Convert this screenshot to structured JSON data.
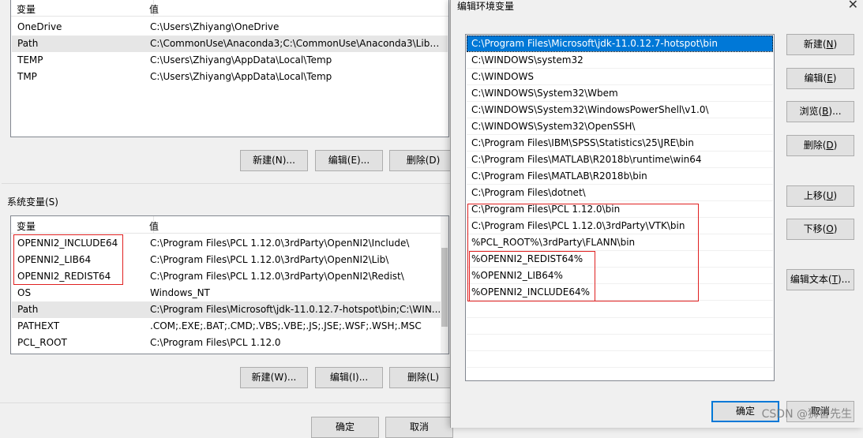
{
  "user_vars": {
    "header": {
      "name": "变量",
      "value": "值"
    },
    "rows": [
      {
        "name": "OneDrive",
        "value": "C:\\Users\\Zhiyang\\OneDrive"
      },
      {
        "name": "Path",
        "value": "C:\\CommonUse\\Anaconda3;C:\\CommonUse\\Anaconda3\\Libr..."
      },
      {
        "name": "TEMP",
        "value": "C:\\Users\\Zhiyang\\AppData\\Local\\Temp"
      },
      {
        "name": "TMP",
        "value": "C:\\Users\\Zhiyang\\AppData\\Local\\Temp"
      }
    ],
    "buttons": {
      "new": "新建(N)...",
      "edit": "编辑(E)...",
      "delete": "删除(D)"
    }
  },
  "system_vars": {
    "group_label": "系统变量(S)",
    "header": {
      "name": "变量",
      "value": "值"
    },
    "rows": [
      {
        "name": "OPENNI2_INCLUDE64",
        "value": "C:\\Program Files\\PCL 1.12.0\\3rdParty\\OpenNI2\\Include\\"
      },
      {
        "name": "OPENNI2_LIB64",
        "value": "C:\\Program Files\\PCL 1.12.0\\3rdParty\\OpenNI2\\Lib\\"
      },
      {
        "name": "OPENNI2_REDIST64",
        "value": "C:\\Program Files\\PCL 1.12.0\\3rdParty\\OpenNI2\\Redist\\"
      },
      {
        "name": "OS",
        "value": "Windows_NT"
      },
      {
        "name": "Path",
        "value": "C:\\Program Files\\Microsoft\\jdk-11.0.12.7-hotspot\\bin;C:\\WIN..."
      },
      {
        "name": "PATHEXT",
        "value": ".COM;.EXE;.BAT;.CMD;.VBS;.VBE;.JS;.JSE;.WSF;.WSH;.MSC"
      },
      {
        "name": "PCL_ROOT",
        "value": "C:\\Program Files\\PCL 1.12.0"
      }
    ],
    "buttons": {
      "new": "新建(W)...",
      "edit": "编辑(I)...",
      "delete": "删除(L)"
    }
  },
  "bottom_buttons": {
    "ok": "确定",
    "cancel": "取消"
  },
  "edit_dialog": {
    "title": "编辑环境变量",
    "entries": [
      "C:\\Program Files\\Microsoft\\jdk-11.0.12.7-hotspot\\bin",
      "C:\\WINDOWS\\system32",
      "C:\\WINDOWS",
      "C:\\WINDOWS\\System32\\Wbem",
      "C:\\WINDOWS\\System32\\WindowsPowerShell\\v1.0\\",
      "C:\\WINDOWS\\System32\\OpenSSH\\",
      "C:\\Program Files\\IBM\\SPSS\\Statistics\\25\\JRE\\bin",
      "C:\\Program Files\\MATLAB\\R2018b\\runtime\\win64",
      "C:\\Program Files\\MATLAB\\R2018b\\bin",
      "C:\\Program Files\\dotnet\\",
      "C:\\Program Files\\PCL 1.12.0\\bin",
      "C:\\Program Files\\PCL 1.12.0\\3rdParty\\VTK\\bin",
      "%PCL_ROOT%\\3rdParty\\FLANN\\bin",
      "%OPENNI2_REDIST64%",
      "%OPENNI2_LIB64%",
      "%OPENNI2_INCLUDE64%"
    ],
    "buttons": {
      "new": {
        "text": "新建(",
        "key": "N",
        "suffix": ")"
      },
      "edit": {
        "text": "编辑(",
        "key": "E",
        "suffix": ")"
      },
      "browse": {
        "text": "浏览(",
        "key": "B",
        "suffix": ")..."
      },
      "delete": {
        "text": "删除(",
        "key": "D",
        "suffix": ")"
      },
      "move_up": {
        "text": "上移(",
        "key": "U",
        "suffix": ")"
      },
      "move_down": {
        "text": "下移(",
        "key": "O",
        "suffix": ")"
      },
      "edit_text": {
        "text": "编辑文本(",
        "key": "T",
        "suffix": ")..."
      },
      "ok": "确定",
      "cancel": "取消"
    },
    "watermark": "CSDN @狮智先生"
  }
}
